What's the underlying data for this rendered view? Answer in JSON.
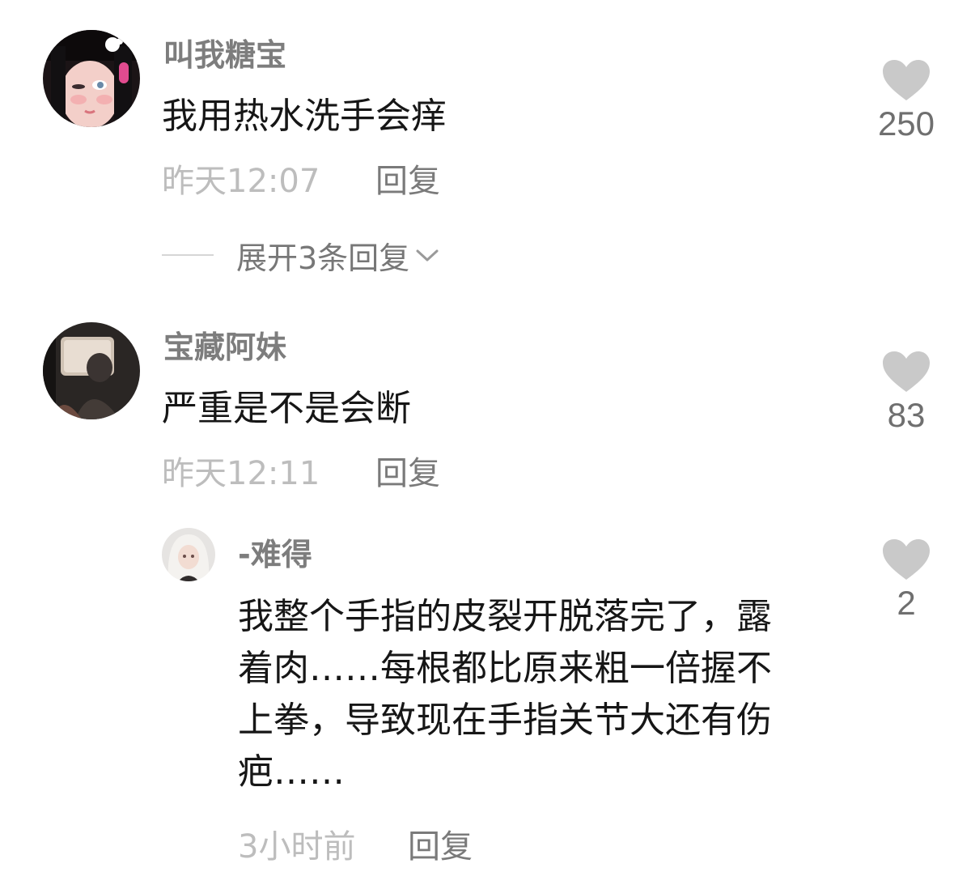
{
  "comments": [
    {
      "username": "叫我糖宝",
      "text": "我用热水洗手会痒",
      "time": "昨天12:07",
      "reply_label": "回复",
      "likes": "250",
      "expand_label": "展开3条回复"
    },
    {
      "username": "宝藏阿妹",
      "text": "严重是不是会断",
      "time": "昨天12:11",
      "reply_label": "回复",
      "likes": "83"
    }
  ],
  "sub_reply": {
    "username": "-难得",
    "lines": [
      "我整个手指的皮裂开脱落完了，露",
      "着肉……每根都比原来粗一倍握不",
      "上拳，导致现在手指关节大还有伤",
      "疤……"
    ],
    "time": "3小时前",
    "reply_label": "回复",
    "likes": "2"
  },
  "icons": {
    "like": "heart-icon",
    "expand": "chevron-down-icon"
  },
  "colors": {
    "heart": "#c9c9c9",
    "username": "#7d7d7d",
    "text": "#161616",
    "time": "#bdbdbd"
  }
}
